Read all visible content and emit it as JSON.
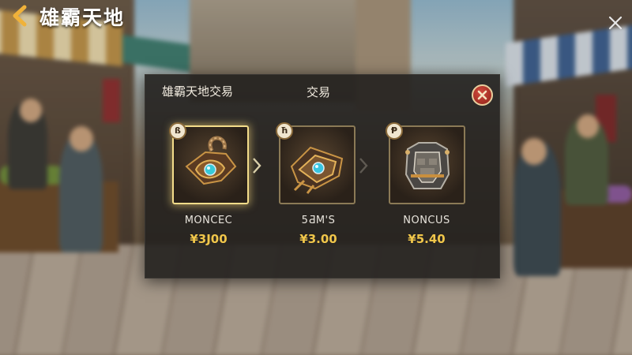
{
  "header": {
    "title": "雄霸天地"
  },
  "dialog": {
    "title": "雄霸天地交易",
    "tab_label": "交易",
    "items": [
      {
        "badge": "ß",
        "name": "MONCEC",
        "price": "¥3J00",
        "selected": true,
        "icon": "amulet-icon"
      },
      {
        "badge": "ħ",
        "name": "5ƋM'S",
        "price": "¥3.00",
        "selected": false,
        "icon": "gauntlet-icon"
      },
      {
        "badge": "Ᵽ",
        "name": "NONCUS",
        "price": "¥5.40",
        "selected": false,
        "icon": "armor-icon"
      }
    ]
  },
  "colors": {
    "price": "#f0c64a",
    "selected_border": "#f3dc8a",
    "close_button": "#b0302a"
  }
}
